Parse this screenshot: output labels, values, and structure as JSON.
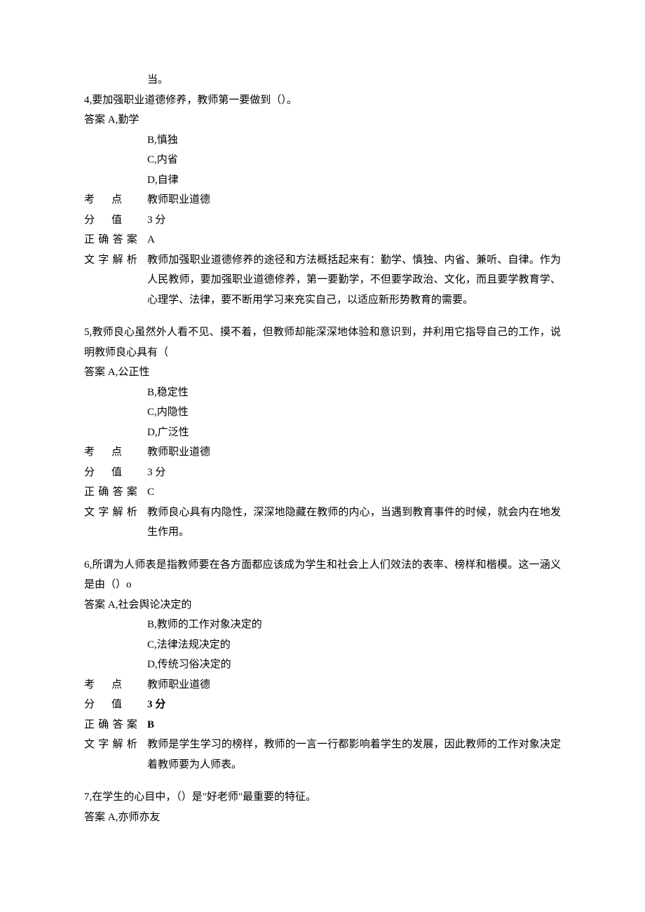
{
  "trail_prev": "当。",
  "q4": {
    "stem": "4,要加强职业道德修养，教师第一要做到（）。",
    "ansA": "答案 A,勤学",
    "optB": "B,慎独",
    "optC": "C,内省",
    "optD": "D,自律",
    "kp_label": "考点",
    "kp": "教师职业道德",
    "score_label": "分值",
    "score": "3 分",
    "correct_label": "正确答案",
    "correct": "A",
    "expl_label": "文字解析",
    "expl": "教师加强职业道德修养的途径和方法概括起来有：勤学、慎独、内省、兼听、自律。作为人民教师，要加强职业道德修养，第一要勤学，不但要学政治、文化，而且要学教育学、心理学、法律，要不断用学习来充实自己，以适应新形势教育的需要。"
  },
  "q5": {
    "stem": "5,教师良心虽然外人看不见、摸不着，但教师却能深深地体验和意识到，并利用它指导自己的工作，说明教师良心具有（",
    "ansA": "答案 A,公正性",
    "optB": "B,稳定性",
    "optC": "C,内隐性",
    "optD": "D,广泛性",
    "kp_label": "考点",
    "kp": "教师职业道德",
    "score_label": "分值",
    "score": "3 分",
    "correct_label": "正确答案",
    "correct": "C",
    "expl_label": "文字解析",
    "expl": "教师良心具有内隐性，深深地隐藏在教师的内心，当遇到教育事件的时候，就会内在地发生作用。"
  },
  "q6": {
    "stem": "6,所谓为人师表是指教师要在各方面都应该成为学生和社会上人们效法的表率、榜样和楷模。这一涵义是由（）o",
    "ansA": "答案 A,社会舆论决定的",
    "optB": "B,教师的工作对象决定的",
    "optC": "C,法律法规决定的",
    "optD": "D,传统习俗决定的",
    "kp_label": "考点",
    "kp": "教师职业道德",
    "score_label": "分值",
    "score": "3 分",
    "correct_label": "正确答案",
    "correct": "B",
    "expl_label": "文字解析",
    "expl": "教师是学生学习的榜样，教师的一言一行都影响着学生的发展，因此教师的工作对象决定着教师要为人师表。"
  },
  "q7": {
    "stem": "7,在学生的心目中，（）是\"好老师\"最重要的特征。",
    "ansA": "答案 A,亦师亦友"
  }
}
